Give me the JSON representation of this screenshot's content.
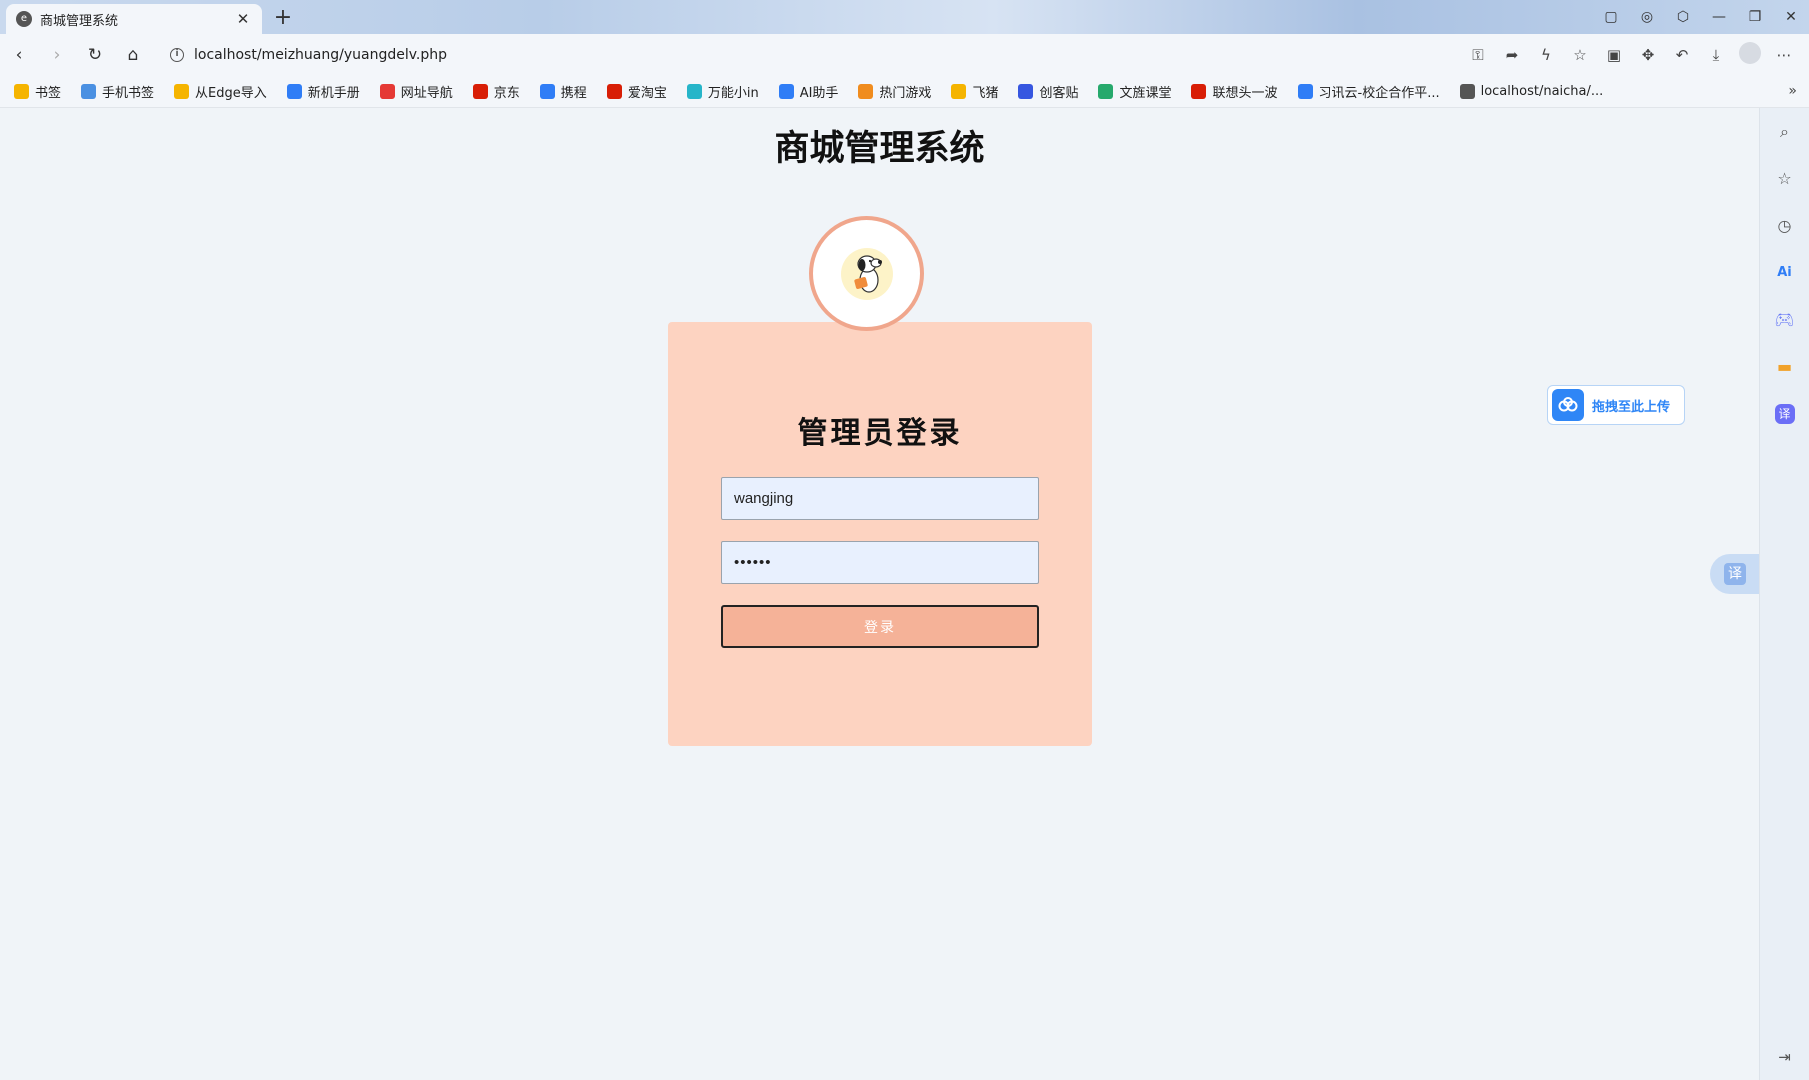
{
  "browser": {
    "tab_title": "商城管理系统",
    "url": "localhost/meizhuang/yuangdelv.php"
  },
  "bookmarks": [
    {
      "label": "书签",
      "color": "#f5b400"
    },
    {
      "label": "手机书签",
      "color": "#4a90e2"
    },
    {
      "label": "从Edge导入",
      "color": "#f5b400"
    },
    {
      "label": "新机手册",
      "color": "#2f7df6"
    },
    {
      "label": "网址导航",
      "color": "#e53935"
    },
    {
      "label": "京东",
      "color": "#d81e06"
    },
    {
      "label": "携程",
      "color": "#2f7df6"
    },
    {
      "label": "爱淘宝",
      "color": "#d81e06"
    },
    {
      "label": "万能小in",
      "color": "#26b5c9"
    },
    {
      "label": "AI助手",
      "color": "#2f7df6"
    },
    {
      "label": "热门游戏",
      "color": "#f08c1e"
    },
    {
      "label": "飞猪",
      "color": "#f5b400"
    },
    {
      "label": "创客贴",
      "color": "#3656e0"
    },
    {
      "label": "文旌课堂",
      "color": "#26a96c"
    },
    {
      "label": "联想头一波",
      "color": "#d81e06"
    },
    {
      "label": "习讯云-校企合作平...",
      "color": "#2f7df6"
    },
    {
      "label": "localhost/naicha/...",
      "color": "#555555"
    }
  ],
  "page": {
    "title": "商城管理系统",
    "login": {
      "heading": "管理员登录",
      "username_value": "wangjing",
      "password_value": "123456",
      "submit_label": "登录"
    }
  },
  "widgets": {
    "upload_label": "拖拽至此上传",
    "translate_label": "译"
  },
  "colors": {
    "card_bg": "#fdd3c1",
    "button_bg": "#f5b298",
    "avatar_border": "#f0a68c",
    "input_bg": "#e8f0fe",
    "upload_accent": "#2f86f6"
  }
}
